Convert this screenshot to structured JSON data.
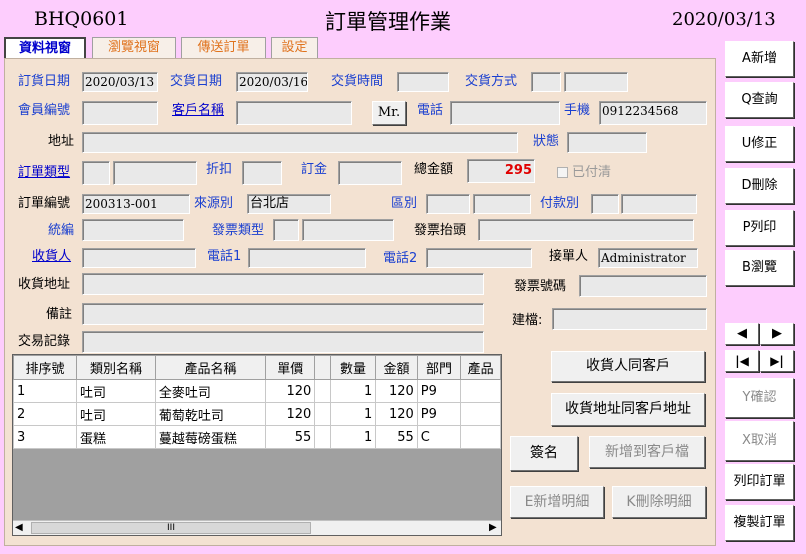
{
  "header": {
    "form_code": "BHQ0601",
    "title": "訂單管理作業",
    "date": "2020/03/13"
  },
  "tabs": [
    {
      "label": "資料視窗"
    },
    {
      "label": "瀏覽視窗"
    },
    {
      "label": "傳送訂單"
    },
    {
      "label": "設定"
    }
  ],
  "form": {
    "order_date_label": "訂貨日期",
    "order_date": "2020/03/13",
    "delivery_date_label": "交貨日期",
    "delivery_date": "2020/03/16",
    "delivery_time_label": "交貨時間",
    "delivery_method_label": "交貨方式",
    "member_no_label": "會員編號",
    "customer_name_label": "客戶名稱",
    "mr_button": "Mr.",
    "phone_label": "電話",
    "mobile_label": "手機",
    "mobile": "0912234568",
    "address_label": "地址",
    "status_label": "狀態",
    "order_type_label": "訂單類型",
    "discount_label": "折扣",
    "deposit_label": "訂金",
    "total_label": "總金額",
    "total": "295",
    "paid_label": "已付清",
    "order_no_label": "訂單編號",
    "order_no": "200313-001",
    "source_label": "來源別",
    "source": "台北店",
    "region_label": "區別",
    "payment_label": "付款別",
    "tax_id_label": "統編",
    "invoice_type_label": "發票類型",
    "invoice_title_label": "發票抬頭",
    "receiver_label": "收貨人",
    "phone1_label": "電話1",
    "phone2_label": "電話2",
    "handler_label": "接單人",
    "handler": "Administrator",
    "ship_address_label": "收貨地址",
    "invoice_no_label": "發票號碼",
    "remark_label": "備註",
    "created_by_label": "建檔:",
    "trade_log_label": "交易記錄"
  },
  "grid": {
    "columns": [
      "排序號",
      "類別名稱",
      "產品名稱",
      "單價",
      "",
      "數量",
      "金額",
      "部門",
      "產品"
    ],
    "rows": [
      {
        "seq": "1",
        "category": "吐司",
        "product": "全麥吐司",
        "price": "120",
        "qty": "1",
        "amount": "120",
        "dept": "P9"
      },
      {
        "seq": "2",
        "category": "吐司",
        "product": "葡萄乾吐司",
        "price": "120",
        "qty": "1",
        "amount": "120",
        "dept": "P9"
      },
      {
        "seq": "3",
        "category": "蛋糕",
        "product": "蔓越莓磅蛋糕",
        "price": "55",
        "qty": "1",
        "amount": "55",
        "dept": "C"
      }
    ],
    "scroll_mark": "III"
  },
  "actions": {
    "same_receiver": "收貨人同客戶",
    "same_address": "收貨地址同客戶地址",
    "sign": "簽名",
    "add_to_customer": "新增到客戶檔",
    "add_detail": "E新增明細",
    "delete_detail": "K刪除明細"
  },
  "sidebar": {
    "new": "A新增",
    "query": "Q查詢",
    "modify": "U修正",
    "delete": "D刪除",
    "print": "P列印",
    "browse": "B瀏覽",
    "first": "|◀",
    "prev": "◀",
    "next": "▶",
    "last": "▶|",
    "confirm": "Y確認",
    "cancel": "X取消",
    "print_order": "列印訂單",
    "copy_order": "複製訂單"
  },
  "colors": {
    "background": "#fdcdfd",
    "panel": "#f3e2d2",
    "total_value": "#e00000",
    "link": "#0000cc"
  }
}
